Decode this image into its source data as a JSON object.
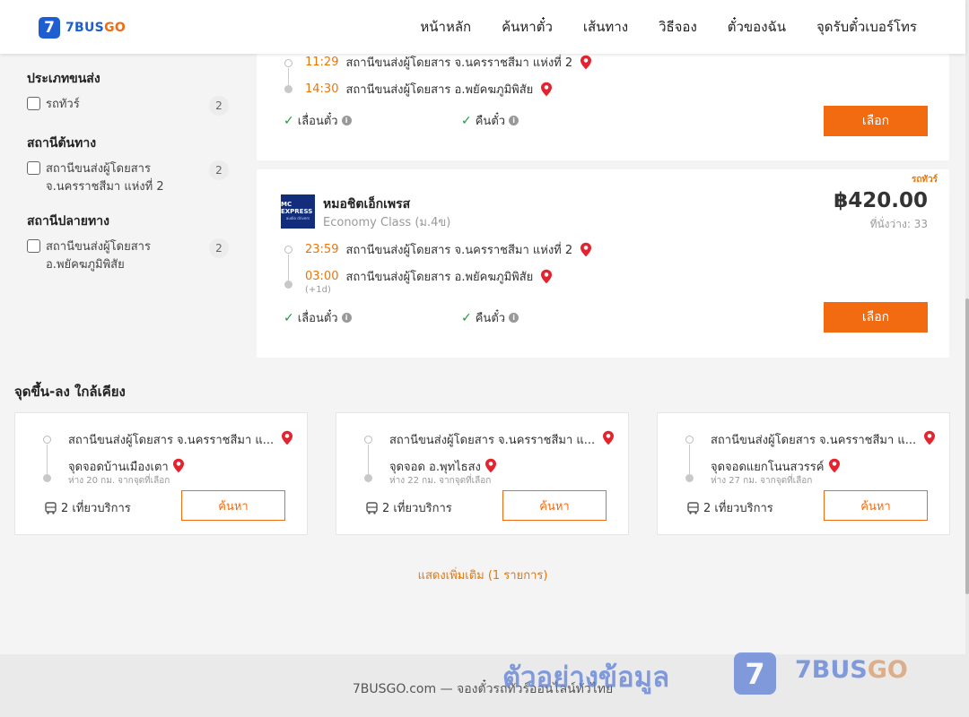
{
  "header": {
    "logo_number": "7",
    "logo_brand_main": "7BUS",
    "logo_brand_go": "GO",
    "nav": [
      "หน้าหลัก",
      "ค้นหาตั๋ว",
      "เส้นทาง",
      "วิธีจอง",
      "ตั๋วของฉัน",
      "จุดรับตั๋วเบอร์โทร"
    ]
  },
  "filters": {
    "transport_type": {
      "title": "ประเภทขนส่ง",
      "options": [
        {
          "label": "รถทัวร์",
          "count": "2"
        }
      ]
    },
    "origin": {
      "title": "สถานีต้นทาง",
      "options": [
        {
          "label": "สถานีขนส่งผู้โดยสาร จ.นครราชสีมา แห่งที่ 2",
          "count": "2"
        }
      ]
    },
    "destination": {
      "title": "สถานีปลายทาง",
      "options": [
        {
          "label": "สถานีขนส่งผู้โดยสาร อ.พยัคฆภูมิพิสัย",
          "count": "2"
        }
      ]
    }
  },
  "results": [
    {
      "depart_time": "11:29",
      "depart_station": "สถานีขนส่งผู้โดยสาร จ.นครราชสีมา แห่งที่ 2",
      "arrive_time": "14:30",
      "arrive_station": "สถานีขนส่งผู้โดยสาร อ.พยัคฆภูมิพิสัย",
      "feature_reschedule": "เลื่อนตั๋ว",
      "feature_refund": "คืนตั๋ว",
      "select_label": "เลือก"
    },
    {
      "tag": "รถทัวร์",
      "operator_logo_main": "MC EXPRESS",
      "operator_logo_sub": "audio drivers",
      "operator": "หมอชิตเอ็กเพรส",
      "class": "Economy Class (ม.4ข)",
      "price": "฿420.00",
      "seats": "ที่นั่งว่าง: 33",
      "depart_time": "23:59",
      "depart_station": "สถานีขนส่งผู้โดยสาร จ.นครราชสีมา แห่งที่ 2",
      "arrive_time": "03:00",
      "arrive_day": "(+1d)",
      "arrive_station": "สถานีขนส่งผู้โดยสาร อ.พยัคฆภูมิพิสัย",
      "feature_reschedule": "เลื่อนตั๋ว",
      "feature_refund": "คืนตั๋ว",
      "select_label": "เลือก"
    }
  ],
  "nearby": {
    "title": "จุดขึ้น-ลง ใกล้เคียง",
    "cards": [
      {
        "from": "สถานีขนส่งผู้โดยสาร จ.นครราชสีมา แ...",
        "to": "จุดจอดบ้านเมืองเตา",
        "distance": "ห่าง 20 กม. จากจุดที่เลือก",
        "trips": "2 เที่ยวบริการ",
        "search_label": "ค้นหา"
      },
      {
        "from": "สถานีขนส่งผู้โดยสาร จ.นครราชสีมา แ...",
        "to": "จุดจอด อ.พุทไธสง",
        "distance": "ห่าง 22 กม. จากจุดที่เลือก",
        "trips": "2 เที่ยวบริการ",
        "search_label": "ค้นหา"
      },
      {
        "from": "สถานีขนส่งผู้โดยสาร จ.นครราชสีมา แ...",
        "to": "จุดจอดแยกโนนสวรรค์",
        "distance": "ห่าง 27 กม. จากจุดที่เลือก",
        "trips": "2 เที่ยวบริการ",
        "search_label": "ค้นหา"
      }
    ],
    "show_more": "แสดงเพิ่มเติม (1 รายการ)"
  },
  "footer": {
    "text": "7BUSGO.com — จองตั๋วรถทัวร์ออนไลน์ทั่วไทย"
  },
  "watermark": {
    "text": "ตัวอย่างข้อมูล",
    "logo_number": "7",
    "brand_main": "7BUS",
    "brand_go": "GO"
  },
  "colors": {
    "accent": "#f26b10",
    "brand_blue": "#1d5fd1",
    "time_orange": "#e8760a",
    "pin_red": "#e5232e",
    "check_green": "#1a9c3c"
  }
}
